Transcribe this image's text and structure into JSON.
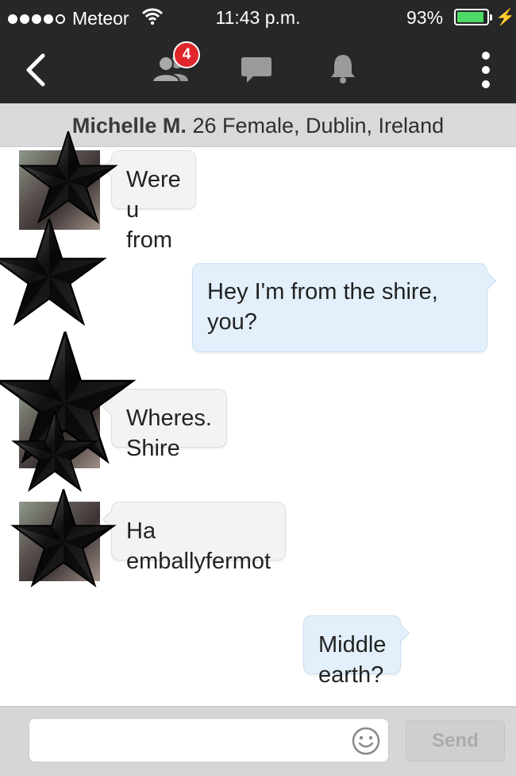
{
  "status_bar": {
    "carrier": "Meteor",
    "time": "11:43 p.m.",
    "battery_percent": "93%",
    "battery_level": 0.93,
    "signal_bars": 4,
    "signal_max": 5
  },
  "nav_bar": {
    "icons": [
      "back-icon",
      "people-icon",
      "chat-icon",
      "bell-icon",
      "more-icon"
    ],
    "people_badge": "4"
  },
  "profile": {
    "name": "Michelle M.",
    "details": "26 Female, Dublin, Ireland"
  },
  "messages": [
    {
      "from": "them",
      "text": "Were u from"
    },
    {
      "from": "me",
      "text": "Hey I'm from the shire, you?"
    },
    {
      "from": "them",
      "text": "Wheres. Shire"
    },
    {
      "from": "them",
      "text": "Ha emballyfermot"
    },
    {
      "from": "me",
      "text": "Middle earth?"
    }
  ],
  "composer": {
    "value": "",
    "send_label": "Send",
    "emoji_icon": "smiley-icon"
  },
  "colors": {
    "bar_background": "#262728",
    "badge": "#e0252b",
    "outgoing_bubble": "#e3f0fb",
    "incoming_bubble": "#f3f3f3",
    "battery_fill": "#4cd964"
  }
}
